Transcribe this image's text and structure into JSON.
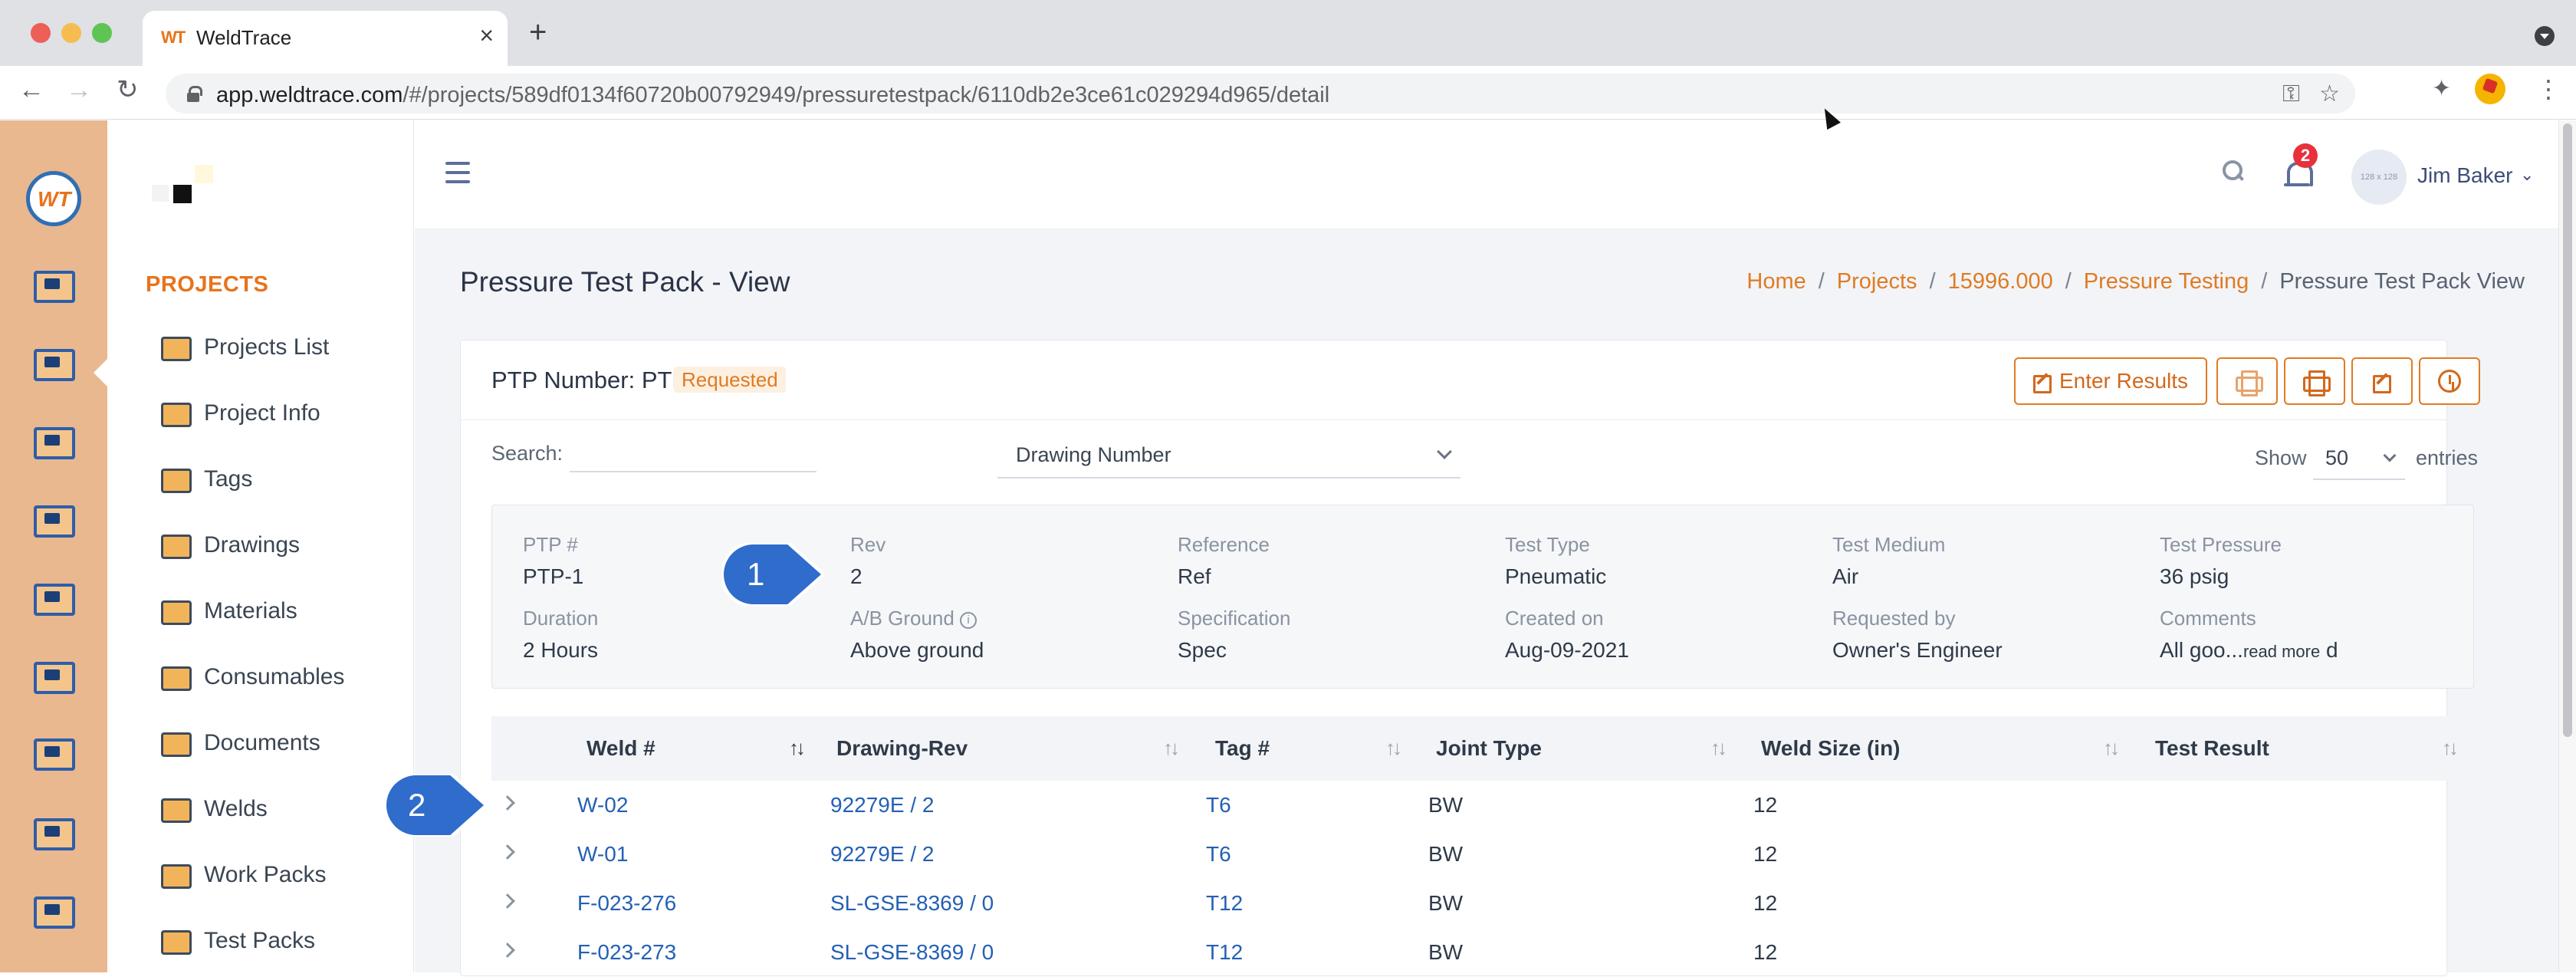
{
  "browser": {
    "tab_title": "WeldTrace",
    "favicon_text": "WT",
    "url_host": "app.weldtrace.com",
    "url_path": "/#/projects/589df0134f60720b00792949/pressuretestpack/6110db2e3ce61c029294d965/detail"
  },
  "header": {
    "notification_count": "2",
    "avatar_text": "128 x 128",
    "user_name": "Jim Baker"
  },
  "sidebar": {
    "heading": "PROJECTS",
    "items": [
      {
        "label": "Projects List",
        "icon": "projects-list-icon"
      },
      {
        "label": "Project Info",
        "icon": "project-info-icon"
      },
      {
        "label": "Tags",
        "icon": "tag-icon"
      },
      {
        "label": "Drawings",
        "icon": "drawings-icon"
      },
      {
        "label": "Materials",
        "icon": "materials-icon"
      },
      {
        "label": "Consumables",
        "icon": "consumables-icon"
      },
      {
        "label": "Documents",
        "icon": "documents-icon"
      },
      {
        "label": "Welds",
        "icon": "welds-icon"
      },
      {
        "label": "Work Packs",
        "icon": "work-packs-icon"
      },
      {
        "label": "Test Packs",
        "icon": "test-packs-icon"
      }
    ]
  },
  "rail": {
    "logo_text": "WT",
    "icons": [
      "monitor-icon",
      "folder-settings-icon",
      "checklist-icon",
      "welder-icon",
      "org-chart-icon",
      "book-icon",
      "team-icon",
      "clipboard-clock-icon",
      "certificate-icon"
    ]
  },
  "page": {
    "title": "Pressure Test Pack - View",
    "breadcrumb": [
      "Home",
      "Projects",
      "15996.000",
      "Pressure Testing",
      "Pressure Test Pack View"
    ],
    "breadcrumb_sep": "/"
  },
  "card": {
    "ptp_label": "PTP Number: PTP-1",
    "status": "Requested",
    "enter_results_label": "Enter Results",
    "search_label": "Search:",
    "search_value": "",
    "filter_select": "Drawing Number",
    "show_label": "Show",
    "page_size": "50",
    "entries_label": "entries"
  },
  "details": {
    "row1": [
      {
        "label": "PTP #",
        "value": "PTP-1"
      },
      {
        "label": "Rev",
        "value": "2"
      },
      {
        "label": "Reference",
        "value": "Ref"
      },
      {
        "label": "Test Type",
        "value": "Pneumatic"
      },
      {
        "label": "Test Medium",
        "value": "Air"
      },
      {
        "label": "Test Pressure",
        "value": "36 psig"
      }
    ],
    "row2": [
      {
        "label": "Duration",
        "value": "2 Hours"
      },
      {
        "label": "A/B Ground",
        "value": "Above ground"
      },
      {
        "label": "Specification",
        "value": "Spec"
      },
      {
        "label": "Created on",
        "value": "Aug-09-2021"
      },
      {
        "label": "Requested by",
        "value": "Owner's Engineer"
      },
      {
        "label": "Comments",
        "value": "All goo...",
        "more": "read more",
        "tail": " d"
      }
    ]
  },
  "callouts": {
    "first": "1",
    "second": "2"
  },
  "table": {
    "columns": [
      "Weld #",
      "Drawing-Rev",
      "Tag #",
      "Joint Type",
      "Weld Size (in)",
      "Test Result"
    ],
    "rows": [
      {
        "weld": "W-02",
        "drawing": "92279E / 2",
        "tag": "T6",
        "joint": "BW",
        "size": "12",
        "result": ""
      },
      {
        "weld": "W-01",
        "drawing": "92279E / 2",
        "tag": "T6",
        "joint": "BW",
        "size": "12",
        "result": ""
      },
      {
        "weld": "F-023-276",
        "drawing": "SL-GSE-8369 / 0",
        "tag": "T12",
        "joint": "BW",
        "size": "12",
        "result": ""
      },
      {
        "weld": "F-023-273",
        "drawing": "SL-GSE-8369 / 0",
        "tag": "T12",
        "joint": "BW",
        "size": "12",
        "result": ""
      }
    ]
  },
  "colors": {
    "accent": "#e07b22",
    "link": "#2460b3",
    "rail": "#e9b88f",
    "callout": "#2f6ccc"
  }
}
